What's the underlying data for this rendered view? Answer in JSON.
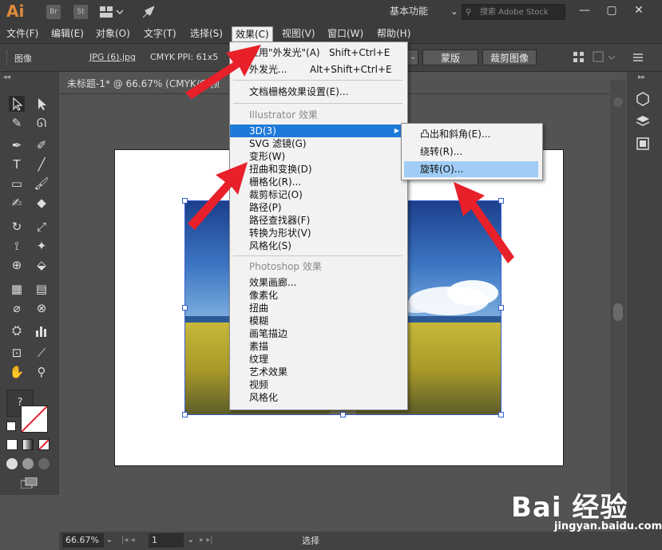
{
  "app": {
    "logo": "Ai",
    "bridge": "Br",
    "stock": "St",
    "workspace": "基本功能",
    "search_placeholder": "搜索 Adobe Stock"
  },
  "menubar": {
    "items": [
      "文件(F)",
      "编辑(E)",
      "对象(O)",
      "文字(T)",
      "选择(S)",
      "效果(C)",
      "视图(V)",
      "窗口(W)",
      "帮助(H)"
    ]
  },
  "controlbar": {
    "label": "图像",
    "filename": "JPG (6).jpg",
    "colormode": "CMYK",
    "ppi": "PPI: 61x5",
    "mask_button": "蒙版",
    "crop_button": "裁剪图像"
  },
  "document": {
    "tab_title": "未标题-1* @ 66.67% (CMYK/G 预"
  },
  "effect_menu": {
    "apply_last": {
      "label": "应用\"外发光\"(A)",
      "shortcut": "Shift+Ctrl+E"
    },
    "last": {
      "label": "外发光...",
      "shortcut": "Alt+Shift+Ctrl+E"
    },
    "raster_settings": "文档栅格效果设置(E)...",
    "illustrator_header": "Illustrator 效果",
    "illustrator_items": [
      "3D(3)",
      "SVG 滤镜(G)",
      "变形(W)",
      "扭曲和变换(D)",
      "栅格化(R)...",
      "裁剪标记(O)",
      "路径(P)",
      "路径查找器(F)",
      "转换为形状(V)",
      "风格化(S)"
    ],
    "photoshop_header": "Photoshop 效果",
    "photoshop_items": [
      "效果画廊...",
      "像素化",
      "扭曲",
      "模糊",
      "画笔描边",
      "素描",
      "纹理",
      "艺术效果",
      "视频",
      "风格化"
    ]
  },
  "submenu_3d": {
    "items": [
      "凸出和斜角(E)...",
      "绕转(R)...",
      "旋转(O)..."
    ],
    "highlighted_index": 2
  },
  "statusbar": {
    "zoom": "66.67%",
    "page": "1",
    "tool": "选择"
  },
  "watermark": {
    "brand": "Bai 经验",
    "url": "jingyan.baidu.com"
  },
  "colors": {
    "menu_highlight": "#1e7ad8",
    "submenu_highlight": "#9fcdf5",
    "arrow_red": "#e8202a"
  }
}
